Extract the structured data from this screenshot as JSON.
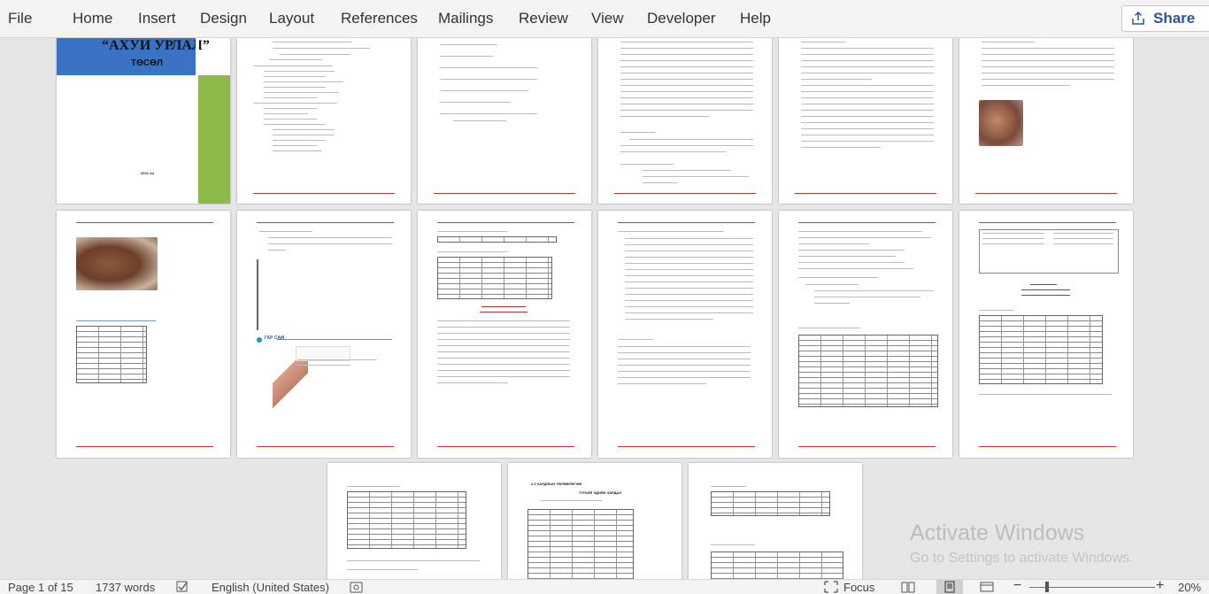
{
  "ribbon": {
    "tabs": [
      "File",
      "Home",
      "Insert",
      "Design",
      "Layout",
      "References",
      "Mailings",
      "Review",
      "View",
      "Developer",
      "Help"
    ],
    "share_label": "Share"
  },
  "document": {
    "cover_title": "“АХУИ УРЛАЛ”",
    "cover_subtitle": "ТӨСӨЛ",
    "cover_year": "2021 он",
    "section_headers": {
      "p9": "ГАР САМ",
      "p13": "2.2 ЗАРДЛЫН ТӨЛӨВЛӨГӨӨ",
      "p13_sub": "ТҮҮХИЙ ЭДИЙН ЗАРДАЛ",
      "p6_title": "3 БҮЛЭГ САНХҮҮГИЙН ТӨЛӨВЛӨГӨӨ",
      "p5_title": "2 БҮЛЭГ ҮЙЛДВЭРЛЭЛ"
    }
  },
  "watermark": {
    "title": "Activate Windows",
    "subtitle": "Go to Settings to activate Windows."
  },
  "statusbar": {
    "page": "Page 1 of 15",
    "words": "1737 words",
    "language": "English (United States)",
    "focus": "Focus",
    "zoom": "20%"
  },
  "colors": {
    "accent": "#2b579a",
    "page_rule": "#cc3333",
    "cover_blue": "#3a73c4",
    "cover_green": "#8dbb49"
  }
}
